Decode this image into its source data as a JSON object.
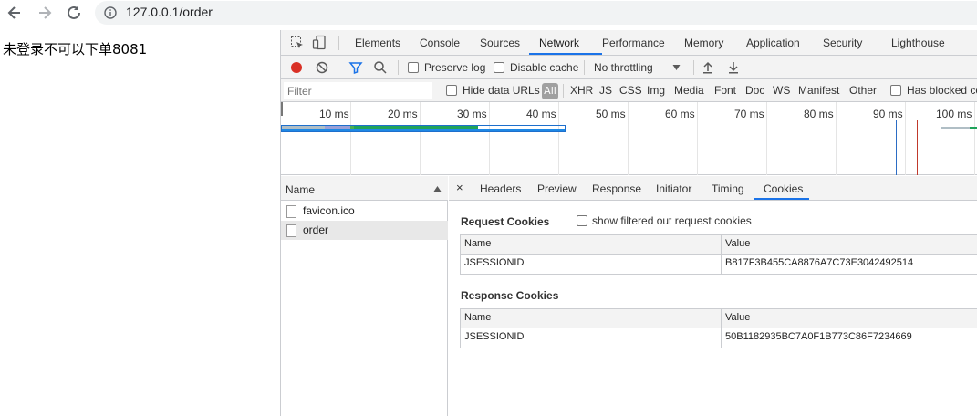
{
  "browser": {
    "url": "127.0.0.1/order"
  },
  "page": {
    "message": "未登录不可以下单8081"
  },
  "devtools": {
    "tabs": [
      "Elements",
      "Console",
      "Sources",
      "Network",
      "Performance",
      "Memory",
      "Application",
      "Security",
      "Lighthouse"
    ],
    "active_tab": "Network",
    "toolbar": {
      "preserve_log": "Preserve log",
      "disable_cache": "Disable cache",
      "throttling": "No throttling"
    },
    "filter": {
      "placeholder": "Filter",
      "hide_data_urls": "Hide data URLs",
      "all": "All",
      "types": [
        "XHR",
        "JS",
        "CSS",
        "Img",
        "Media",
        "Font",
        "Doc",
        "WS",
        "Manifest",
        "Other"
      ],
      "has_blocked": "Has blocked co"
    },
    "timeline": {
      "ticks": [
        "10 ms",
        "20 ms",
        "30 ms",
        "40 ms",
        "50 ms",
        "60 ms",
        "70 ms",
        "80 ms",
        "90 ms",
        "100 ms"
      ]
    },
    "requests": {
      "header": "Name",
      "items": [
        "favicon.ico",
        "order"
      ],
      "selected": "order"
    },
    "detail": {
      "close": "×",
      "tabs": [
        "Headers",
        "Preview",
        "Response",
        "Initiator",
        "Timing",
        "Cookies"
      ],
      "active_tab": "Cookies",
      "request_cookies": {
        "title": "Request Cookies",
        "show_filtered": "show filtered out request cookies",
        "columns": [
          "Name",
          "Value"
        ],
        "rows": [
          [
            "JSESSIONID",
            "B817F3B455CA8876A7C73E3042492514"
          ]
        ]
      },
      "response_cookies": {
        "title": "Response Cookies",
        "columns": [
          "Name",
          "Value"
        ],
        "rows": [
          [
            "JSESSIONID",
            "50B1182935BC7A0F1B773C86F7234669"
          ]
        ]
      }
    }
  }
}
